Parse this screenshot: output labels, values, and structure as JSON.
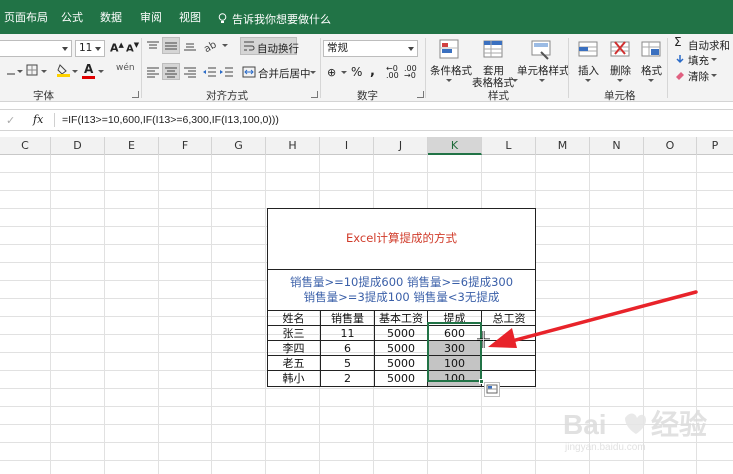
{
  "menu_tabs": [
    "页面布局",
    "公式",
    "数据",
    "审阅",
    "视图"
  ],
  "tell_me": "告诉我你想要做什么",
  "ribbon": {
    "font_size": "11",
    "font_group_label": "字体",
    "alignment": {
      "wrap_text": "自动换行",
      "merge_center": "合并后居中",
      "group_label": "对齐方式"
    },
    "number": {
      "format": "常规",
      "group_label": "数字"
    },
    "styles": {
      "conditional": "条件格式",
      "table_format_line1": "套用",
      "table_format_line2": "表格格式",
      "cell_styles": "单元格样式",
      "group_label": "样式"
    },
    "cells": {
      "insert": "插入",
      "delete": "删除",
      "format": "格式",
      "group_label": "单元格"
    },
    "editing": {
      "autosum": "自动求和",
      "fill": "填充",
      "clear": "清除"
    }
  },
  "formula_bar": {
    "fx": "fx",
    "formula": "=IF(I13>=10,600,IF(I13>=6,300,IF(I13,100,0)))"
  },
  "columns": [
    "C",
    "D",
    "E",
    "F",
    "G",
    "H",
    "I",
    "J",
    "K",
    "L",
    "M",
    "N",
    "O",
    "P"
  ],
  "active_column": "K",
  "sheet": {
    "title": "Excel计算提成的方式",
    "rule_line1": "销售量>=10提成600  销售量>=6提成300",
    "rule_line2": "销售量>=3提成100  销售量<3无提成",
    "headers": [
      "姓名",
      "销售量",
      "基本工资",
      "提成",
      "总工资"
    ],
    "rows": [
      [
        "张三",
        "11",
        "5000",
        "600",
        ""
      ],
      [
        "李四",
        "6",
        "5000",
        "300",
        ""
      ],
      [
        "老五",
        "5",
        "5000",
        "100",
        ""
      ],
      [
        "韩小",
        "2",
        "5000",
        "100",
        ""
      ]
    ]
  },
  "colors": {
    "excel_green": "#217346",
    "title_red": "#d03b2a",
    "rule_blue": "#3a5fa8",
    "arrow_red": "#e8232a",
    "selection_gray": "#c4c4c4"
  }
}
